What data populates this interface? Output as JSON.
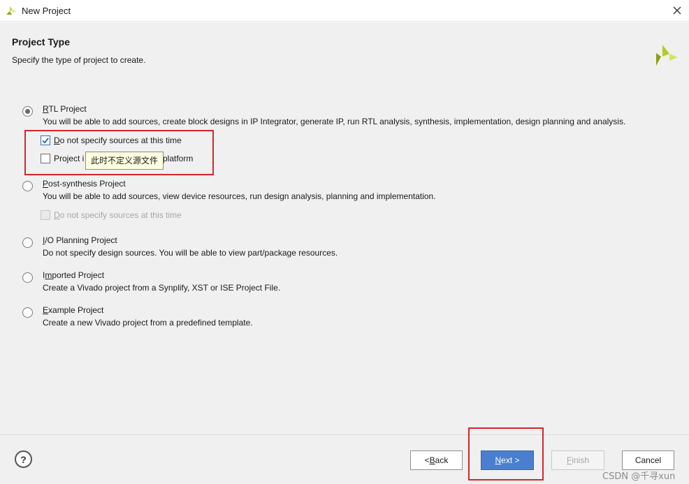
{
  "window": {
    "title": "New Project",
    "close_symbol": "✕"
  },
  "header": {
    "title": "Project Type",
    "subtitle": "Specify the type of project to create."
  },
  "options": [
    {
      "key": "rtl",
      "mnemonic": "R",
      "label_rest": "TL Project",
      "description": "You will be able to add sources, create block designs in IP Integrator, generate IP, run RTL analysis, synthesis, implementation, design planning and analysis.",
      "selected": true,
      "sub_options": [
        {
          "mnemonic": "D",
          "label_rest": "o not specify sources at this time",
          "checked": true,
          "enabled": true
        },
        {
          "label_start": "Project i",
          "label_end": "platform",
          "checked": false,
          "enabled": true
        }
      ]
    },
    {
      "key": "post-synthesis",
      "mnemonic": "P",
      "label_rest": "ost-synthesis Project",
      "description": "You will be able to add sources, view device resources, run design analysis, planning and implementation.",
      "selected": false,
      "sub_options": [
        {
          "mnemonic": "D",
          "label_rest": "o not specify sources at this time",
          "checked": false,
          "enabled": false
        }
      ]
    },
    {
      "key": "io-planning",
      "mnemonic": "I",
      "label_rest": "/O Planning Project",
      "description": "Do not specify design sources. You will be able to view part/package resources.",
      "selected": false
    },
    {
      "key": "imported",
      "label_start": "I",
      "mnemonic": "m",
      "label_rest": "ported Project",
      "description": "Create a Vivado project from a Synplify, XST or ISE Project File.",
      "selected": false
    },
    {
      "key": "example",
      "mnemonic": "E",
      "label_rest": "xample Project",
      "description": "Create a new Vivado project from a predefined template.",
      "selected": false
    }
  ],
  "tooltip": "此时不定义源文件",
  "footer": {
    "help_symbol": "?",
    "back": {
      "prefix": "< ",
      "mnemonic": "B",
      "rest": "ack"
    },
    "next": {
      "mnemonic": "N",
      "rest": "ext >"
    },
    "finish": {
      "mnemonic": "F",
      "rest": "inish"
    },
    "cancel": "Cancel",
    "watermark": "CSDN @千寻xun"
  },
  "colors": {
    "primary_button": "#4a7fcf",
    "highlight": "#d6262e",
    "tooltip_bg": "#ffffe1",
    "logo_green": "#9bb318"
  }
}
